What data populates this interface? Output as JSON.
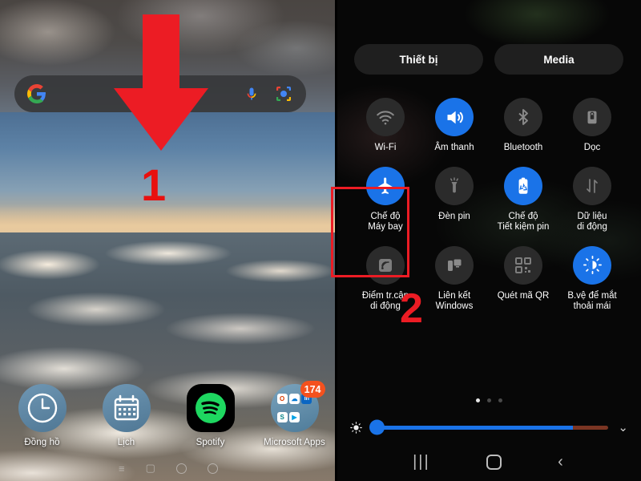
{
  "left_phone": {
    "search_bar": {
      "google_icon": "google-g-icon",
      "mic_icon": "microphone-icon",
      "lens_icon": "google-lens-icon",
      "placeholder": ""
    },
    "dock_apps": [
      {
        "label": "Đồng hồ",
        "icon": "clock-icon",
        "badge": ""
      },
      {
        "label": "Lịch",
        "icon": "calendar-icon",
        "badge": ""
      },
      {
        "label": "Spotify",
        "icon": "spotify-icon",
        "badge": ""
      },
      {
        "label": "Microsoft Apps",
        "icon": "folder-icon",
        "badge": "174"
      }
    ],
    "folder_minis": [
      "O",
      "☁",
      "in",
      "S",
      "▶"
    ],
    "nav_bar": {
      "recents": "≡",
      "home": "▢",
      "back": "○"
    },
    "annotation": {
      "step_number": "1",
      "arrow": "arrow-down-icon",
      "color": "#ec1c24"
    }
  },
  "right_phone": {
    "segments": [
      {
        "label": "Thiết bị"
      },
      {
        "label": "Media"
      }
    ],
    "tiles": [
      {
        "label": "Wi-Fi",
        "icon": "wifi-icon",
        "active": false
      },
      {
        "label": "Âm thanh",
        "icon": "volume-icon",
        "active": true
      },
      {
        "label": "Bluetooth",
        "icon": "bluetooth-icon",
        "active": false
      },
      {
        "label": "Dọc",
        "icon": "rotation-lock-icon",
        "active": false
      },
      {
        "label": "Chế độ\nMáy bay",
        "icon": "airplane-icon",
        "active": true
      },
      {
        "label": "Đèn pin",
        "icon": "flashlight-icon",
        "active": false
      },
      {
        "label": "Chế độ\nTiết kiệm pin",
        "icon": "battery-saver-icon",
        "active": true
      },
      {
        "label": "Dữ liệu\ndi động",
        "icon": "mobile-data-icon",
        "active": false
      },
      {
        "label": "Điểm tr.cập\ndi động",
        "icon": "hotspot-icon",
        "active": false
      },
      {
        "label": "Liên kết\nWindows",
        "icon": "link-to-windows-icon",
        "active": false
      },
      {
        "label": "Quét mã QR",
        "icon": "qr-scan-icon",
        "active": false
      },
      {
        "label": "B.vệ để mắt\nthoải mái",
        "icon": "eye-comfort-icon",
        "active": true
      }
    ],
    "page_dots": {
      "count": 3,
      "active_index": 0
    },
    "brightness": {
      "icon": "brightness-icon",
      "value_percent": 85,
      "expand_icon": "chevron-down-icon"
    },
    "nav_bar": {
      "recents": "|||",
      "home": "home-square-icon",
      "back": "‹"
    },
    "annotation": {
      "step_number": "2",
      "highlight_target": "Chế độ Máy bay",
      "color": "#ec1c24"
    }
  },
  "colors": {
    "accent_blue": "#1a73e8",
    "annotation_red": "#ec1c24",
    "tile_off": "#2b2b2b",
    "badge_orange": "#f4511e"
  }
}
